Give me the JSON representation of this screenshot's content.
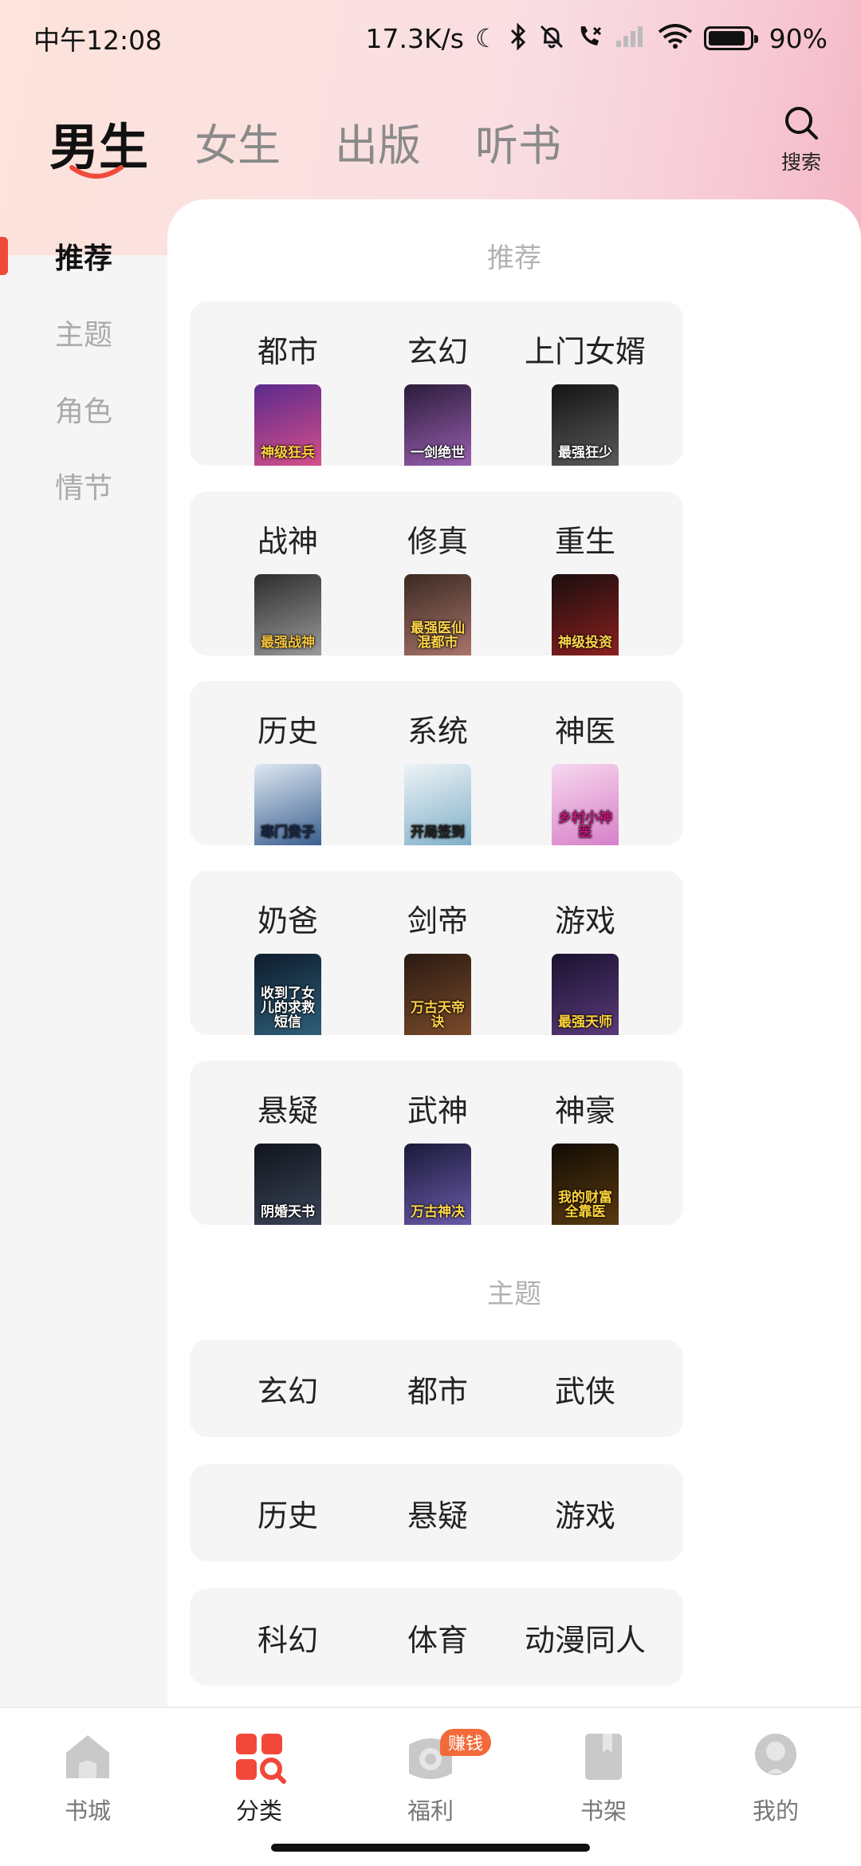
{
  "status_bar": {
    "time": "中午12:08",
    "net_speed": "17.3K/s",
    "battery": "90%",
    "battery_level": 0.9
  },
  "top_tabs": [
    {
      "label": "男生",
      "active": true
    },
    {
      "label": "女生",
      "active": false
    },
    {
      "label": "出版",
      "active": false
    },
    {
      "label": "听书",
      "active": false
    }
  ],
  "search": {
    "label": "搜索",
    "icon": "search-icon"
  },
  "sidebar": {
    "items": [
      {
        "label": "推荐",
        "active": true
      },
      {
        "label": "主题",
        "active": false
      },
      {
        "label": "角色",
        "active": false
      },
      {
        "label": "情节",
        "active": false
      }
    ]
  },
  "sections": {
    "recommend": {
      "title": "推荐",
      "cards": [
        {
          "label": "都市",
          "cover_title": "神级狂兵",
          "colors": [
            "#5b2a8c",
            "#d64f8a"
          ],
          "text_color": "#ffd23a"
        },
        {
          "label": "玄幻",
          "cover_title": "一剑绝世",
          "colors": [
            "#2a1c3a",
            "#9a5fb0"
          ],
          "text_color": "#ffffff"
        },
        {
          "label": "上门女婿",
          "cover_title": "最强狂少",
          "colors": [
            "#141414",
            "#5a5a5a"
          ],
          "text_color": "#ffffff"
        },
        {
          "label": "战神",
          "cover_title": "最强战神",
          "colors": [
            "#2d2d2d",
            "#9a9a9a"
          ],
          "text_color": "#f3c23a"
        },
        {
          "label": "修真",
          "cover_title": "最强医仙混都市",
          "colors": [
            "#3a2a22",
            "#a8736a"
          ],
          "text_color": "#ffd54a"
        },
        {
          "label": "重生",
          "cover_title": "神级投资",
          "colors": [
            "#1a0e0e",
            "#8c1f1f"
          ],
          "text_color": "#ffd54a"
        },
        {
          "label": "历史",
          "cover_title": "寒门贵子",
          "colors": [
            "#dfe8f2",
            "#3a5f90"
          ],
          "text_color": "#1a2a44"
        },
        {
          "label": "系统",
          "cover_title": "开局签到",
          "colors": [
            "#eef3f6",
            "#7fb0c8"
          ],
          "text_color": "#222222"
        },
        {
          "label": "神医",
          "cover_title": "乡村小神医",
          "colors": [
            "#f7d8ee",
            "#d77fc8"
          ],
          "text_color": "#c0147a"
        },
        {
          "label": "奶爸",
          "cover_title": "收到了女儿的求救短信",
          "colors": [
            "#0e1c2c",
            "#2f5f7a"
          ],
          "text_color": "#ffffff"
        },
        {
          "label": "剑帝",
          "cover_title": "万古天帝诀",
          "colors": [
            "#2a1a12",
            "#7a4a2a"
          ],
          "text_color": "#ffcf4a"
        },
        {
          "label": "游戏",
          "cover_title": "最强天师",
          "colors": [
            "#1a1230",
            "#5a3a7a"
          ],
          "text_color": "#ffd23a"
        },
        {
          "label": "悬疑",
          "cover_title": "阴婚天书",
          "colors": [
            "#10141c",
            "#3a4458"
          ],
          "text_color": "#ffffff"
        },
        {
          "label": "武神",
          "cover_title": "万古神决",
          "colors": [
            "#1a1a3a",
            "#6a5aa8"
          ],
          "text_color": "#ffd54a"
        },
        {
          "label": "神豪",
          "cover_title": "我的财富全靠医",
          "colors": [
            "#120c04",
            "#5a3a10"
          ],
          "text_color": "#ffd23a"
        }
      ]
    },
    "theme": {
      "title": "主题",
      "pills": [
        "玄幻",
        "都市",
        "武侠",
        "历史",
        "悬疑",
        "游戏",
        "科幻",
        "体育",
        "动漫同人"
      ]
    }
  },
  "bottom_nav": [
    {
      "label": "书城",
      "icon": "home-icon",
      "active": false
    },
    {
      "label": "分类",
      "icon": "category-icon",
      "active": true
    },
    {
      "label": "福利",
      "icon": "gift-icon",
      "active": false,
      "badge": "赚钱"
    },
    {
      "label": "书架",
      "icon": "bookshelf-icon",
      "active": false
    },
    {
      "label": "我的",
      "icon": "profile-icon",
      "active": false
    }
  ],
  "colors": {
    "accent": "#f04a3a",
    "category_red": "#f2483a",
    "badge": "#f26a3a"
  }
}
